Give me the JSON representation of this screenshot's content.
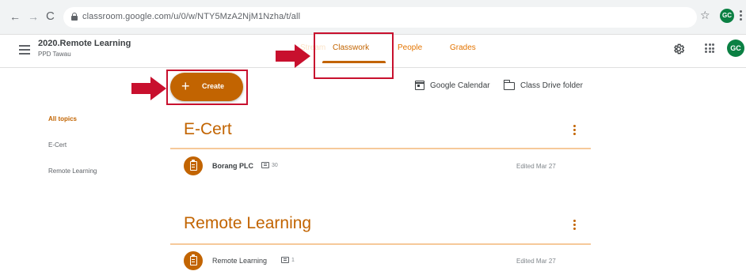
{
  "browser": {
    "back": "←",
    "forward": "→",
    "reload": "C",
    "url": "classroom.google.com/u/0/w/NTY5MzA2NjM1Nzha/t/all",
    "star": "☆",
    "profile_initials": "GC"
  },
  "header": {
    "class_title": "2020.Remote Learning",
    "class_subtitle": "PPD Tawau",
    "tabs": [
      {
        "label": "Stream"
      },
      {
        "label": "Classwork",
        "active": true
      },
      {
        "label": "People"
      },
      {
        "label": "Grades"
      }
    ],
    "avatar_initials": "GC"
  },
  "toolbar": {
    "create_label": "Create",
    "calendar_label": "Google Calendar",
    "drive_label": "Class Drive folder"
  },
  "topics_sidebar": {
    "items": [
      {
        "label": "All topics",
        "active": true
      },
      {
        "label": "E-Cert"
      },
      {
        "label": "Remote Learning"
      }
    ]
  },
  "sections": [
    {
      "title": "E-Cert",
      "items": [
        {
          "title": "Borang PLC",
          "comments": "30",
          "edited": "Edited Mar 27"
        }
      ]
    },
    {
      "title": "Remote Learning",
      "items": [
        {
          "title": "Remote Learning",
          "comments": "1",
          "edited": "Edited Mar 27"
        }
      ]
    }
  ],
  "colors": {
    "accent": "#c26401",
    "annotation_red": "#c8102e",
    "avatar": "#0b8043"
  },
  "icons": [
    "lock-icon",
    "star-icon",
    "hamburger-icon",
    "gear-icon",
    "apps-icon",
    "calendar-icon",
    "folder-icon",
    "assignment-icon",
    "comment-icon",
    "more-vert-icon"
  ]
}
